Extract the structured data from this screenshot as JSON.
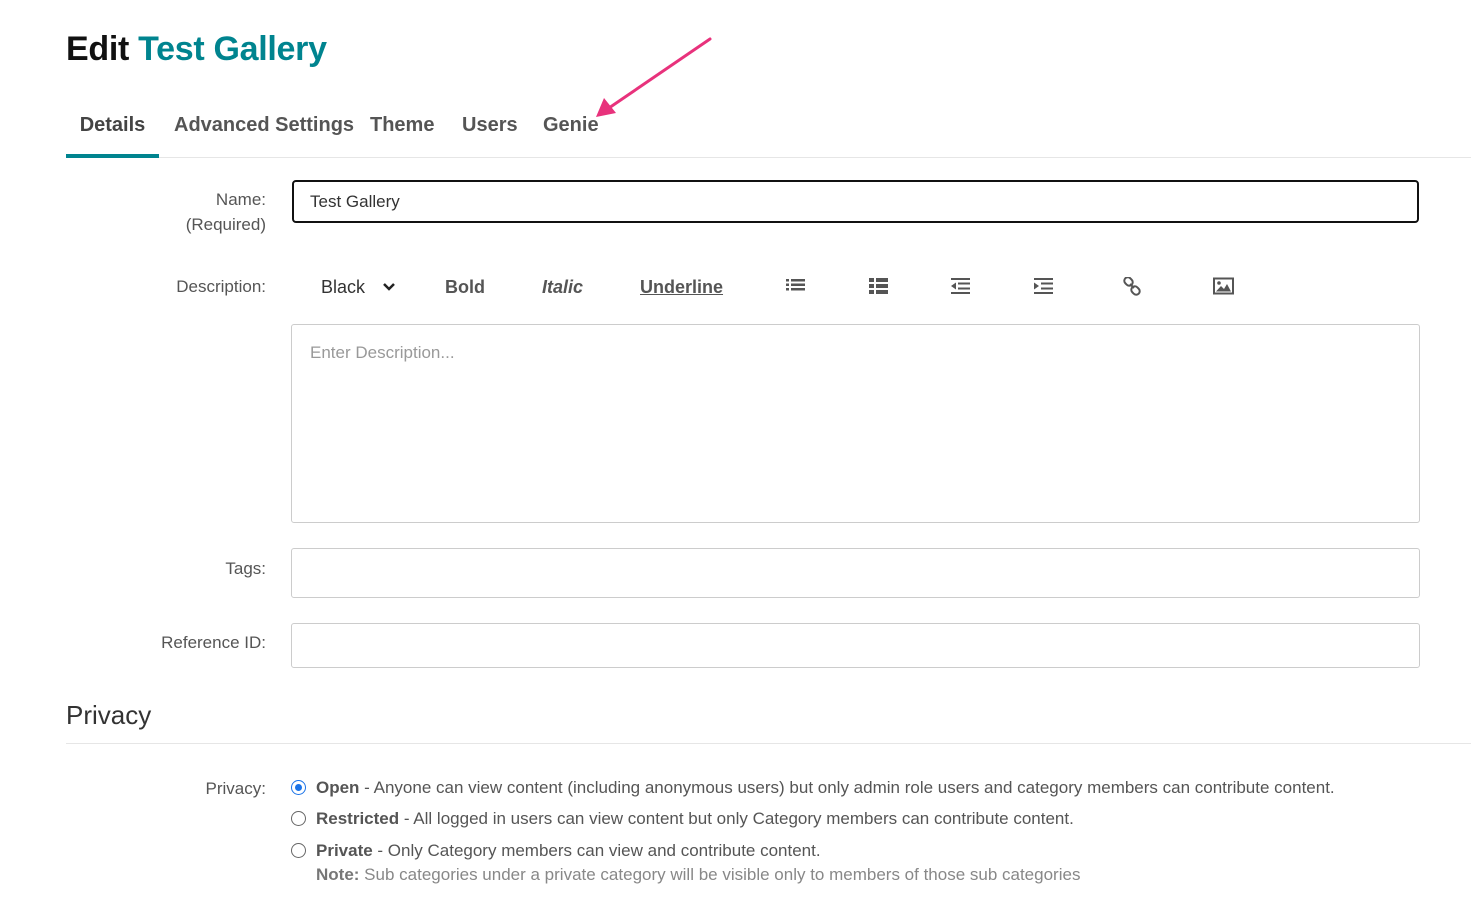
{
  "page": {
    "title_prefix": "Edit",
    "title_name": "Test Gallery",
    "accent_color": "#00848f"
  },
  "tabs": [
    {
      "label": "Details",
      "active": true
    },
    {
      "label": "Advanced Settings",
      "active": false
    },
    {
      "label": "Theme",
      "active": false
    },
    {
      "label": "Users",
      "active": false
    },
    {
      "label": "Genie",
      "active": false
    }
  ],
  "annotation": {
    "type": "arrow",
    "color": "#e8327c",
    "points_to": "Genie"
  },
  "form": {
    "name_label": "Name:",
    "name_required": "(Required)",
    "name_value": "Test Gallery",
    "description_label": "Description:",
    "description_placeholder": "Enter Description...",
    "tags_label": "Tags:",
    "tags_value": "",
    "reference_label": "Reference ID:",
    "reference_value": ""
  },
  "toolbar": {
    "color_select": "Black",
    "bold": "Bold",
    "italic": "Italic",
    "underline": "Underline",
    "icons": [
      "bullet-list-icon",
      "numbered-list-icon",
      "outdent-icon",
      "indent-icon",
      "link-icon",
      "image-icon"
    ]
  },
  "privacy": {
    "section_title": "Privacy",
    "label": "Privacy:",
    "options": [
      {
        "title": "Open",
        "desc": " - Anyone can view content (including anonymous users) but only admin role users and category members can contribute content.",
        "checked": true
      },
      {
        "title": "Restricted",
        "desc": " - All logged in users can view content but only Category members can contribute content.",
        "checked": false
      },
      {
        "title": "Private",
        "desc": " - Only Category members can view and contribute content.",
        "checked": false
      }
    ],
    "note_label": "Note:",
    "note_text": " Sub categories under a private category will be visible only to members of those sub categories"
  }
}
